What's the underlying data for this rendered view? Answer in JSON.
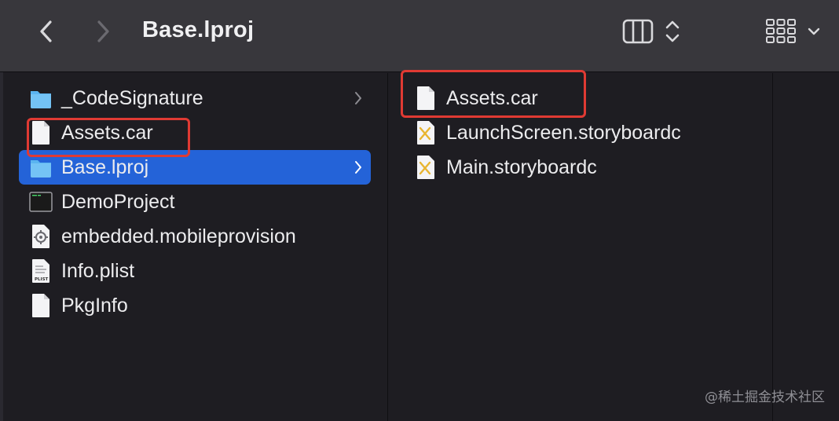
{
  "window": {
    "title": "Base.lproj"
  },
  "toolbar": {
    "back_icon": "chevron-left-icon",
    "forward_icon": "chevron-right-icon",
    "view_mode_icon": "column-view-icon",
    "view_sort_icon": "updown-chevron-icon",
    "group_icon": "icon-grid-icon",
    "group_menu_icon": "chevron-down-icon"
  },
  "column1": {
    "items": [
      {
        "label": "_CodeSignature",
        "icon": "folder-icon",
        "has_children": true,
        "selected": false
      },
      {
        "label": "Assets.car",
        "icon": "document-icon",
        "has_children": false,
        "selected": false
      },
      {
        "label": "Base.lproj",
        "icon": "folder-icon",
        "has_children": true,
        "selected": true
      },
      {
        "label": "DemoProject",
        "icon": "terminal-executable-icon",
        "has_children": false,
        "selected": false
      },
      {
        "label": "embedded.mobileprovision",
        "icon": "provision-gear-icon",
        "has_children": false,
        "selected": false
      },
      {
        "label": "Info.plist",
        "icon": "plist-icon",
        "has_children": false,
        "selected": false
      },
      {
        "label": "PkgInfo",
        "icon": "document-icon",
        "has_children": false,
        "selected": false
      }
    ]
  },
  "column2": {
    "items": [
      {
        "label": "Assets.car",
        "icon": "document-icon"
      },
      {
        "label": "LaunchScreen.storyboardc",
        "icon": "storyboard-icon"
      },
      {
        "label": "Main.storyboardc",
        "icon": "storyboard-icon"
      }
    ]
  },
  "annotations": {
    "color": "#e03a33"
  },
  "colors": {
    "selection": "#2463d8",
    "folder": "#5ab4f0"
  },
  "watermark": "@稀土掘金技术社区"
}
